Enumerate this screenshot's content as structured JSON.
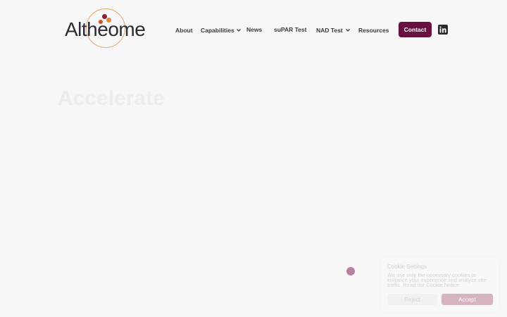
{
  "brand": {
    "name": "Altheome",
    "accent": "#6a1040",
    "ring_color": "#e3a56a",
    "dot_colors": [
      "#d84d2b",
      "#8b1e2e",
      "#e08a3a",
      "#6a1040"
    ]
  },
  "nav": {
    "items": [
      {
        "label": "About",
        "has_dropdown": false
      },
      {
        "label": "Capabilities",
        "has_dropdown": true
      },
      {
        "label": "News",
        "has_dropdown": false
      },
      {
        "label": "suPAR Test",
        "has_dropdown": false
      },
      {
        "label": "NAD Test",
        "has_dropdown": true
      },
      {
        "label": "Resources",
        "has_dropdown": false
      }
    ],
    "contact_label": "Contact",
    "social_icon": "linkedin-icon"
  },
  "hero": {
    "title": "Accelerate"
  },
  "cookie": {
    "title": "Cookie Settings",
    "text": "We use only the necessary cookies to enhance your experience and analyze site traffic. Read our ",
    "link": "Cookie Notice",
    "text_end": ".",
    "reject_label": "Reject",
    "accept_label": "Accept"
  }
}
